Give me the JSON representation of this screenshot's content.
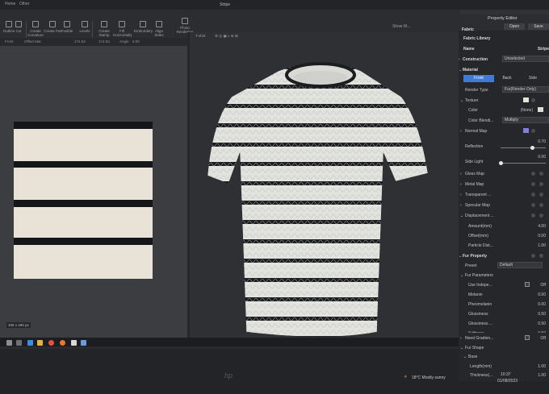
{
  "window": {
    "title": "Stripe",
    "menu": [
      "Home",
      "Other"
    ]
  },
  "toolbar": {
    "tools": [
      "Outline",
      "Cut",
      "Create Curvature",
      "Create Pat",
      "Fusible",
      "Levels",
      "Create Stamp",
      "Fill Horizontally",
      "Embroidery",
      "Align Sides",
      "Photo Rendering"
    ],
    "subbar": [
      "Front",
      "Offset Mat",
      "174.63",
      "174.63",
      "Angle",
      "0.00"
    ],
    "view_tab": "T-shirt",
    "show_mesh": "Show M..."
  },
  "pattern_window": {
    "size_label": "495 x 495 px"
  },
  "property_editor": {
    "title": "Property Editor",
    "open_label": "Open",
    "save_label": "Save",
    "fabric_label": "Fabric",
    "fabric_library": "Fabric Library",
    "name_label": "Name",
    "name_value": "Stripe",
    "construction_label": "Construction",
    "construction_value": "Unselected",
    "material_label": "Material",
    "tabs": [
      "Front",
      "Back",
      "Side"
    ],
    "render_type_label": "Render Type",
    "render_type_value": "Fur(Render Only)",
    "texture_label": "Texture",
    "color_label": "Color",
    "color_value": "(None)",
    "color_blend_label": "Color Blendi...",
    "color_blend_value": "Multiply",
    "normal_map_label": "Normal Map",
    "reflection_label": "Reflection",
    "reflection_value": "0.70",
    "side_light_label": "Side Light",
    "side_light_value": "0.00",
    "gloss_map_label": "Gloss Map",
    "metal_map_label": "Metal Map",
    "transparent_label": "Transparent ...",
    "specular_label": "Specular Map",
    "displacement_label": "Displacement ...",
    "amount_label": "Amount(mm)",
    "amount_value": "4.00",
    "offset_label": "Offset(mm)",
    "offset_value": "0.00",
    "particle_label": "Particle Dist...",
    "particle_value": "1.00",
    "fur_property_label": "Fur Property",
    "preset_label": "Preset",
    "preset_value": "Default",
    "fur_params_label": "Fur Parameters",
    "use_indep_label": "Use Indepe...",
    "use_indep_value": "Off",
    "melanin_label": "Melanin",
    "melanin_value": "0.00",
    "pheomelanin_label": "Pheomelanin",
    "pheomelanin_value": "0.00",
    "glossiness_label": "Glossiness",
    "glossiness_value": "0.50",
    "glossiness2_label": "Glossiness ...",
    "glossiness2_value": "0.50",
    "softness_label": "Softness",
    "softness_value": "0.50",
    "need_gradient_label": "Need Gradien...",
    "need_gradient_value": "Off",
    "fur_shape_label": "Fur Shape",
    "base_label": "Base",
    "length_label": "Length(mm)",
    "length_value": "1.00",
    "thickness_label": "Thickness(...",
    "thickness_value": "1.00"
  },
  "taskbar": {
    "weather": "18°C  Mostly sunny",
    "time": "10:37",
    "date": "01/08/2023"
  },
  "colors": {
    "accent": "#3d7bd9",
    "stripe_dark": "#15161a",
    "fabric_light": "#e9e2d6",
    "shirt_light": "#e2e2df"
  }
}
